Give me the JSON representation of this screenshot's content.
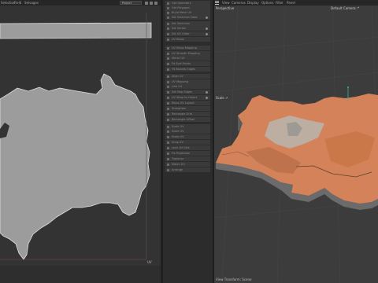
{
  "uv_editor": {
    "menu": [
      "Selection",
      "Field",
      "Selvages"
    ],
    "projection_dropdown": "Project",
    "menu_icons": [
      "lock-icon",
      "settings-icon",
      "grid-icon"
    ],
    "axis_label": "UV"
  },
  "command_column": {
    "items": [
      {
        "label": "Get Geometry"
      },
      {
        "label": "Get Polygons"
      },
      {
        "label": "Build Mesh UV"
      },
      {
        "label": "Set Selection Data"
      },
      {
        "label": "Set Selection"
      },
      {
        "label": "Set Vertex"
      },
      {
        "label": "Set UV Order"
      },
      {
        "label": "UV Relax"
      },
      {
        "label": "UV Relax Mapping"
      },
      {
        "label": "UV Smooth Mapping"
      },
      {
        "label": "Mirror UV"
      },
      {
        "label": "Fit Sort Points"
      },
      {
        "label": "Fit Bounds Edges"
      },
      {
        "label": "Align UV"
      },
      {
        "label": "UV Mapping"
      },
      {
        "label": "Line UV"
      },
      {
        "label": "Set Map Edges"
      },
      {
        "label": "UV Wrap to Object"
      },
      {
        "label": "Relax UV Layout"
      },
      {
        "label": "Straighten"
      },
      {
        "label": "Rectangle Grid"
      },
      {
        "label": "Rectangle Offset"
      },
      {
        "label": "Scale UV"
      },
      {
        "label": "Scale UV"
      },
      {
        "label": "Scale UV"
      },
      {
        "label": "Snap UV"
      },
      {
        "label": "Lock UV Grid"
      },
      {
        "label": "Fix Projection"
      },
      {
        "label": "Triplanar"
      },
      {
        "label": "Match UV"
      },
      {
        "label": "Arrange"
      }
    ]
  },
  "viewport": {
    "menu": [
      "View",
      "Cameras",
      "Display",
      "Options",
      "Filter",
      "Panel"
    ],
    "perspective_label": "Perspective",
    "camera_label": "Default Camera :*",
    "grid_label": "Scale ↗",
    "status": "View Transform: Scene",
    "colors": {
      "terrain_top": "#d4825a",
      "terrain_side": "#6b6b6b",
      "background": "#3c3c3c",
      "axis_y": "#2fb68c"
    }
  }
}
